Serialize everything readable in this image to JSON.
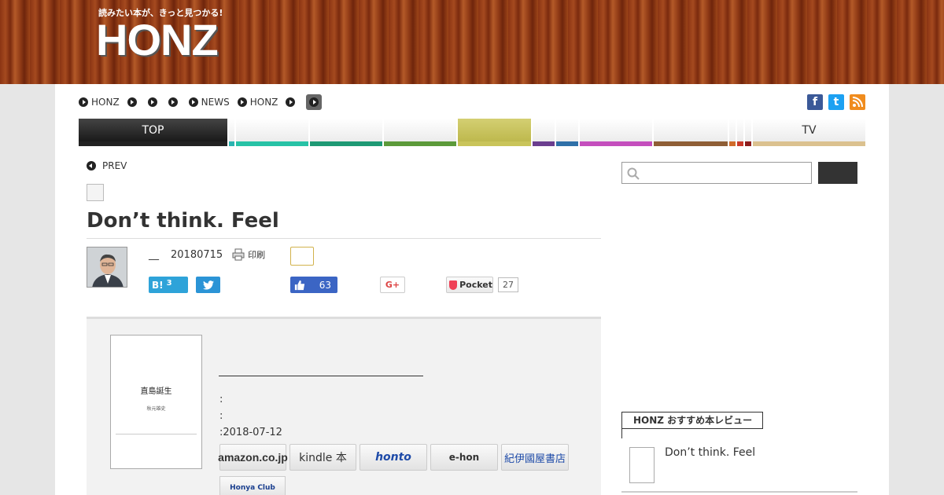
{
  "site": {
    "tagline": "読みたい本が、きっと見つかる!",
    "logo": "HONZ"
  },
  "nav": {
    "items": [
      "HONZ",
      "",
      "",
      "",
      "NEWS",
      "HONZ",
      "",
      ""
    ]
  },
  "social_top": [
    "f",
    "t",
    "rss"
  ],
  "category_tabs": [
    {
      "label": "TOP",
      "color": "#222222"
    },
    {
      "label": "",
      "color": "#2ab4b0"
    },
    {
      "label": "",
      "color": "#27c2a6"
    },
    {
      "label": "",
      "color": "#1e9974"
    },
    {
      "label": "",
      "color": "#5c9a3a"
    },
    {
      "label": "",
      "color": "#c9c45a"
    },
    {
      "label": "",
      "color": "#6b3e8f"
    },
    {
      "label": "",
      "color": "#2f70a8"
    },
    {
      "label": "",
      "color": "#c44ebd"
    },
    {
      "label": "",
      "color": "#8f5e36"
    },
    {
      "label": "",
      "color": "#d06b2a"
    },
    {
      "label": "",
      "color": "#c93a2a"
    },
    {
      "label": "",
      "color": "#8e1d1d"
    },
    {
      "label": "TV",
      "color": "#dbc18f"
    }
  ],
  "article": {
    "prev_label": "PREV",
    "title": "Don’t think. Feel",
    "author_name": "__",
    "date": "20180715",
    "print_label": "印刷"
  },
  "share": {
    "hatena_label": "B!",
    "hatena_count": "3",
    "like_count": "63",
    "gplus_label": "G+",
    "pocket_label": "Pocket",
    "pocket_count": "27"
  },
  "book": {
    "cover_title": "直島誕生",
    "cover_author": "秋元雄史",
    "info_line1": ":",
    "info_line2": ":",
    "info_line3": ":2018-07-12",
    "shops": [
      "amazon.co.jp",
      "kindle 本",
      "honto",
      "e-hon",
      "紀伊國屋書店"
    ],
    "honya": "Honya Club"
  },
  "sidebar": {
    "recommend_heading": "HONZ おすすめ本レビュー",
    "recommend_title": "Don’t think. Feel"
  },
  "colors": {
    "facebook": "#3b5998",
    "twitter": "#1da1f2",
    "rss": "#f08c1e"
  }
}
